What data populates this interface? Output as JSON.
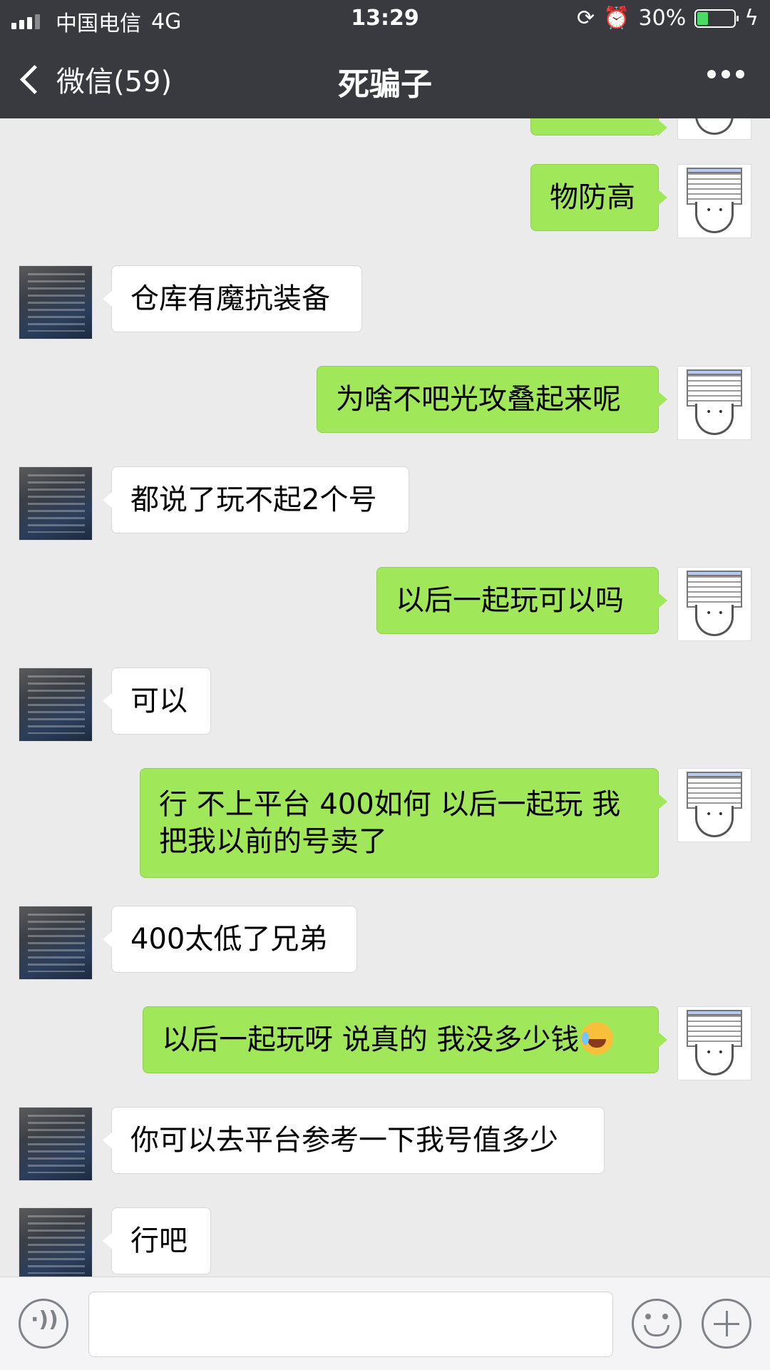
{
  "status_bar": {
    "carrier": "中国电信",
    "network": "4G",
    "time": "13:29",
    "battery": "30%",
    "battery_level": 0.3
  },
  "nav": {
    "back_label": "微信(59)",
    "title": "死骗子"
  },
  "messages": [
    {
      "from": "me",
      "text": ""
    },
    {
      "from": "me",
      "text": "物防高"
    },
    {
      "from": "them",
      "text": "仓库有魔抗装备"
    },
    {
      "from": "me",
      "text": "为啥不吧光攻叠起来呢"
    },
    {
      "from": "them",
      "text": "都说了玩不起2个号"
    },
    {
      "from": "me",
      "text": "以后一起玩可以吗"
    },
    {
      "from": "them",
      "text": "可以"
    },
    {
      "from": "me",
      "text": "行 不上平台 400如何 以后一起玩 我把我以前的号卖了"
    },
    {
      "from": "them",
      "text": "400太低了兄弟"
    },
    {
      "from": "me",
      "text": "以后一起玩呀 说真的 我没多少钱",
      "emoji": "crying-laughing-emoji"
    },
    {
      "from": "them",
      "text": "你可以去平台参考一下我号值多少"
    },
    {
      "from": "them",
      "text": "行吧"
    }
  ],
  "input_bar": {
    "text_value": "",
    "icons": [
      "voice-icon",
      "emoji-icon",
      "plus-icon"
    ]
  },
  "colors": {
    "nav_bg": "#393a3f",
    "chat_bg": "#ebebeb",
    "my_bubble": "#a0e75a",
    "their_bubble": "#ffffff"
  }
}
